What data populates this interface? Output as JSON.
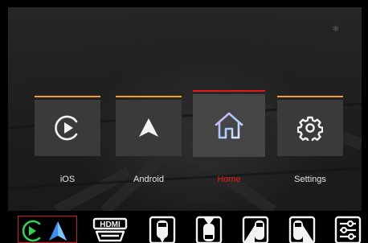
{
  "status": {
    "icon": "bluetooth-icon"
  },
  "apps": [
    {
      "id": "ios",
      "label": "iOS",
      "icon": "play-circle-icon",
      "bar_color": "#f0a020",
      "selected": false
    },
    {
      "id": "android",
      "label": "Android",
      "icon": "android-auto-icon",
      "bar_color": "#f0a020",
      "selected": false
    },
    {
      "id": "home",
      "label": "Home",
      "icon": "home-icon",
      "bar_color": "#e11a1a",
      "selected": true
    },
    {
      "id": "settings",
      "label": "Settings",
      "icon": "gear-icon",
      "bar_color": "#f0a020",
      "selected": false
    }
  ],
  "dock": [
    {
      "id": "carplay-android-auto",
      "icons": [
        "carplay-icon",
        "android-auto-icon"
      ],
      "selected": true
    },
    {
      "id": "hdmi",
      "label": "HDMI",
      "icon": "hdmi-icon",
      "selected": false
    },
    {
      "id": "front-camera",
      "icon": "front-camera-icon",
      "selected": false
    },
    {
      "id": "rear-camera",
      "icon": "rear-camera-icon",
      "selected": false
    },
    {
      "id": "left-camera",
      "icon": "left-camera-icon",
      "selected": false
    },
    {
      "id": "right-camera",
      "icon": "right-camera-icon",
      "selected": false
    },
    {
      "id": "adjust",
      "icon": "sliders-icon",
      "selected": false
    }
  ],
  "colors": {
    "accent_selected": "#e11a1a",
    "accent_bar": "#f0a020",
    "carplay_green": "#2fd158",
    "android_blue": "#3a8ff0"
  }
}
